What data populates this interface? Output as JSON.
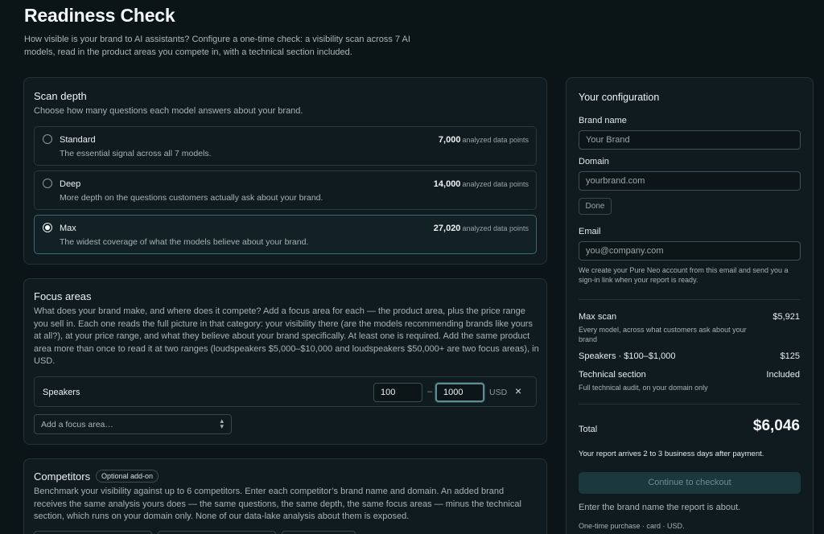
{
  "page": {
    "title": "Readiness Check",
    "intro": "How visible is your brand to AI assistants? Configure a one-time check: a visibility scan across 7 AI models, read in the product areas you compete in, with a technical section included."
  },
  "scan": {
    "title": "Scan depth",
    "subtitle": "Choose how many questions each model answers about your brand.",
    "points_suffix": "analyzed data points",
    "options": [
      {
        "name": "Standard",
        "desc": "The essential signal across all 7 models.",
        "points": "7,000",
        "selected": false
      },
      {
        "name": "Deep",
        "desc": "More depth on the questions customers actually ask about your brand.",
        "points": "14,000",
        "selected": false
      },
      {
        "name": "Max",
        "desc": "The widest coverage of what the models believe about your brand.",
        "points": "27,020",
        "selected": true
      }
    ]
  },
  "focus": {
    "title": "Focus areas",
    "description": "What does your brand make, and where does it compete? Add a focus area for each — the product area, plus the price range you sell in. Each one reads the full picture in that category: your visibility there (are the models recommending brands like yours at all?), at your price range, and what they believe about your brand specifically. At least one is required. Add the same product area more than once to read it at two ranges (loudspeakers $5,000–$10,000 and loudspeakers $50,000+ are two focus areas), in USD.",
    "row": {
      "label": "Speakers",
      "min": "100",
      "dash": "–",
      "max": "1000",
      "currency": "USD",
      "remove": "×"
    },
    "add_placeholder": "Add a focus area…"
  },
  "competitors": {
    "title": "Competitors",
    "badge": "Optional add-on",
    "description": "Benchmark your visibility against up to 6 competitors. Enter each competitor’s brand name and domain. An added brand receives the same analysis yours does — the same questions, the same depth, the same focus areas — minus the technical section, which runs on your domain only. None of our data-lake analysis about them is exposed."
  },
  "config": {
    "title": "Your configuration",
    "brand_label": "Brand name",
    "brand_placeholder": "Your Brand",
    "domain_label": "Domain",
    "domain_placeholder": "yourbrand.com",
    "done_label": "Done",
    "email_label": "Email",
    "email_placeholder": "you@company.com",
    "email_note": "We create your Pure Neo account from this email and send you a sign-in link when your report is ready.",
    "lines": [
      {
        "name": "Max scan",
        "price": "$5,921",
        "note": "Every model, across what customers ask about your brand"
      },
      {
        "name": "Speakers · $100–$1,000",
        "price": "$125",
        "note": ""
      },
      {
        "name": "Technical section",
        "price": "Included",
        "note": "Full technical audit, on your domain only"
      }
    ],
    "total_label": "Total",
    "total_value": "$6,046",
    "arrival": "Your report arrives 2 to 3 business days after payment.",
    "checkout_label": "Continue to checkout",
    "hint": "Enter the brand name the report is about.",
    "fineprint": "One-time purchase · card · USD."
  }
}
